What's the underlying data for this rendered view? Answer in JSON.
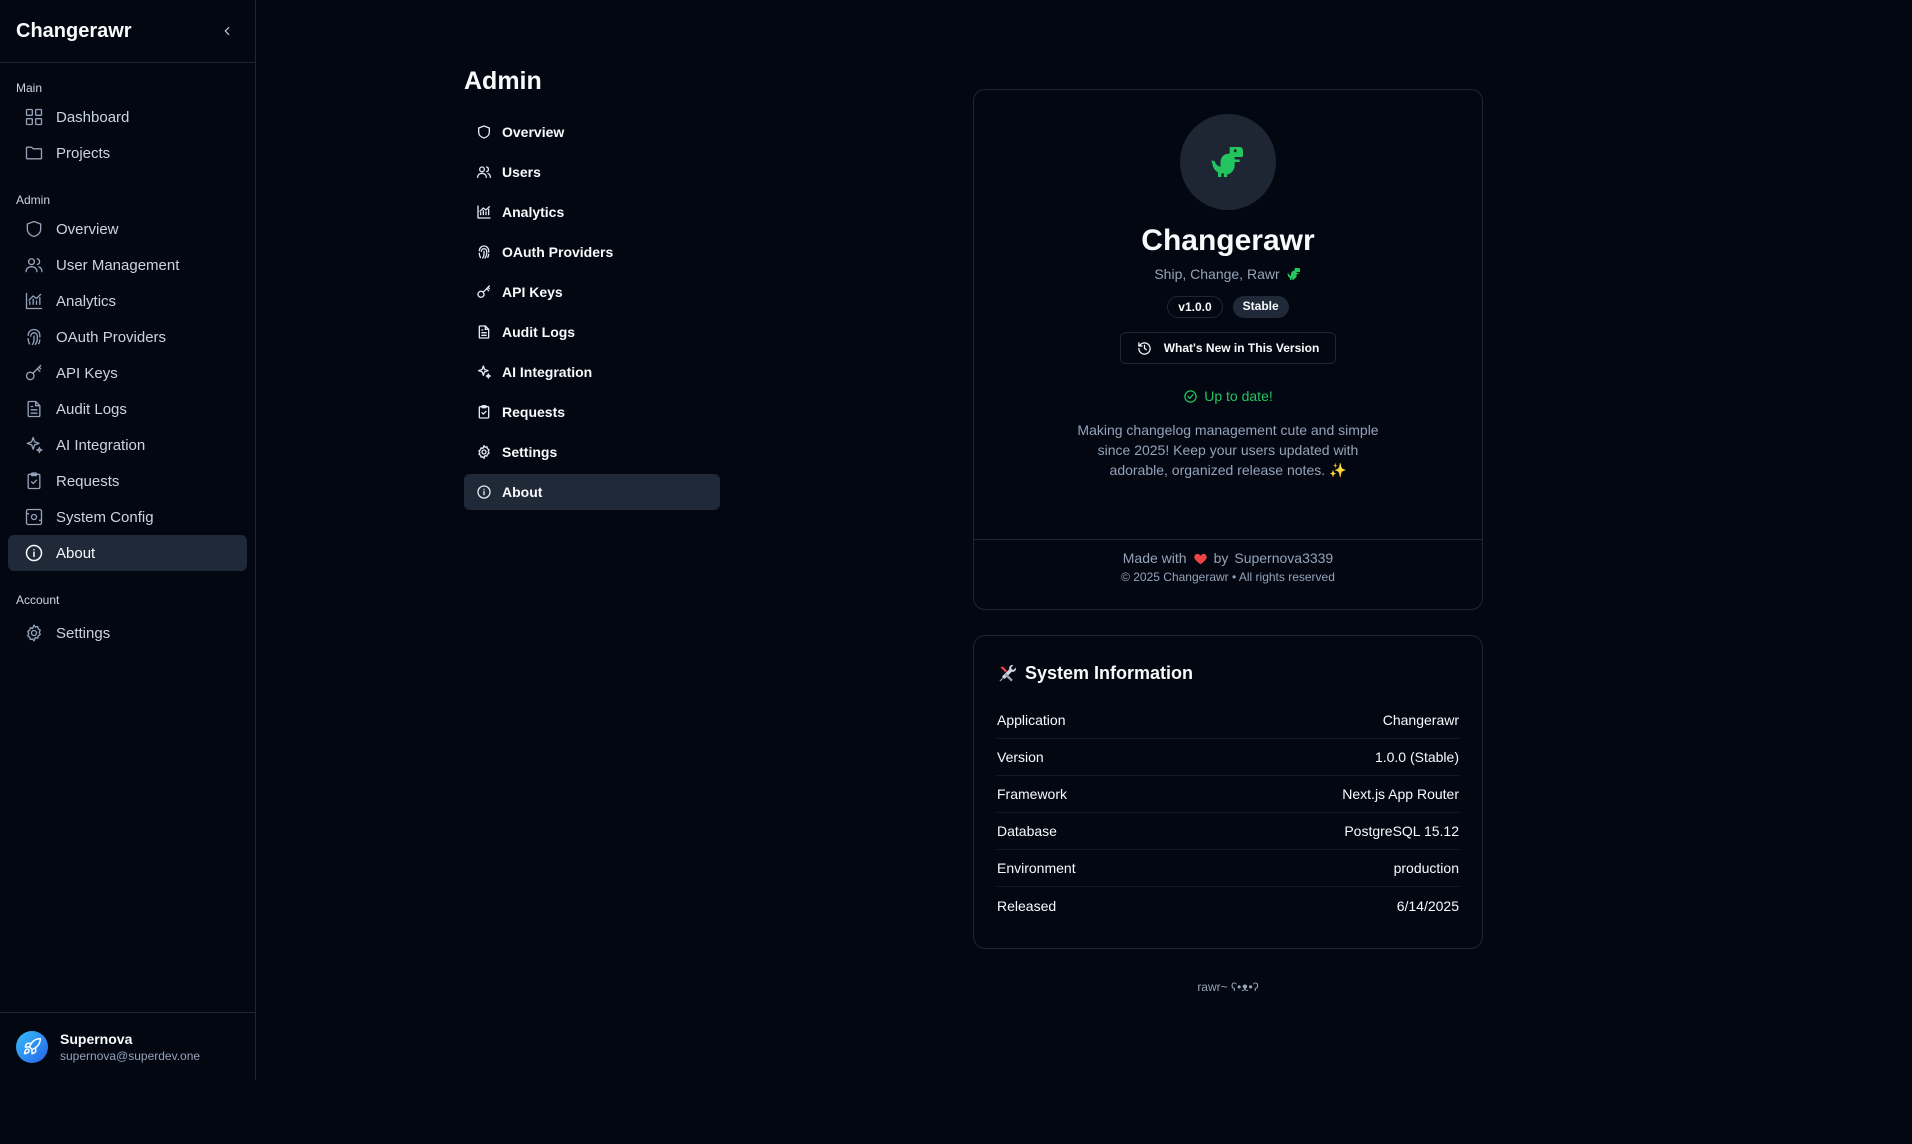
{
  "sidebar": {
    "brand": "Changerawr",
    "groups": {
      "main": "Main",
      "admin": "Admin",
      "account": "Account"
    },
    "main_items": [
      {
        "label": "Dashboard",
        "icon": "dashboard-icon"
      },
      {
        "label": "Projects",
        "icon": "folder-icon"
      }
    ],
    "admin_items": [
      {
        "label": "Overview",
        "icon": "shield-icon"
      },
      {
        "label": "User Management",
        "icon": "users-icon"
      },
      {
        "label": "Analytics",
        "icon": "chart-icon"
      },
      {
        "label": "OAuth Providers",
        "icon": "fingerprint-icon"
      },
      {
        "label": "API Keys",
        "icon": "key-icon"
      },
      {
        "label": "Audit Logs",
        "icon": "file-text-icon"
      },
      {
        "label": "AI Integration",
        "icon": "sparkles-icon"
      },
      {
        "label": "Requests",
        "icon": "clipboard-check-icon"
      },
      {
        "label": "System Config",
        "icon": "settings-panel-icon"
      },
      {
        "label": "About",
        "icon": "info-icon",
        "active": true
      }
    ],
    "account_items": [
      {
        "label": "Settings",
        "icon": "gear-icon"
      }
    ],
    "user": {
      "name": "Supernova",
      "email": "supernova@superdev.one"
    }
  },
  "admin": {
    "title": "Admin",
    "nav": [
      {
        "label": "Overview",
        "icon": "shield-icon"
      },
      {
        "label": "Users",
        "icon": "users-icon"
      },
      {
        "label": "Analytics",
        "icon": "chart-icon"
      },
      {
        "label": "OAuth Providers",
        "icon": "fingerprint-icon"
      },
      {
        "label": "API Keys",
        "icon": "key-icon"
      },
      {
        "label": "Audit Logs",
        "icon": "file-text-icon"
      },
      {
        "label": "AI Integration",
        "icon": "sparkles-icon"
      },
      {
        "label": "Requests",
        "icon": "clipboard-check-icon"
      },
      {
        "label": "Settings",
        "icon": "gear-icon"
      },
      {
        "label": "About",
        "icon": "info-icon",
        "active": true
      }
    ]
  },
  "about": {
    "app_name": "Changerawr",
    "tagline": "Ship, Change, Rawr",
    "version_badge": "v1.0.0",
    "channel_badge": "Stable",
    "whats_new_label": "What's New in This Version",
    "status": "Up to date!",
    "description": "Making changelog management cute and simple since 2025! Keep your users updated with adorable, organized release notes. ✨",
    "made_with_prefix": "Made with",
    "made_with_by": "by",
    "author": "Supernova3339",
    "copyright": "© 2025 Changerawr • All rights reserved",
    "colors": {
      "status": "#22c55e",
      "heart": "#ef4444",
      "dino": "#22c55e"
    }
  },
  "system_info": {
    "title": "System Information",
    "rows": [
      {
        "label": "Application",
        "value": "Changerawr"
      },
      {
        "label": "Version",
        "value": "1.0.0 (Stable)"
      },
      {
        "label": "Framework",
        "value": "Next.js App Router"
      },
      {
        "label": "Database",
        "value": "PostgreSQL 15.12"
      },
      {
        "label": "Environment",
        "value": "production"
      },
      {
        "label": "Released",
        "value": "6/14/2025"
      }
    ]
  },
  "footer_text": "rawr~ ʕ•ᴥ•ʔ"
}
